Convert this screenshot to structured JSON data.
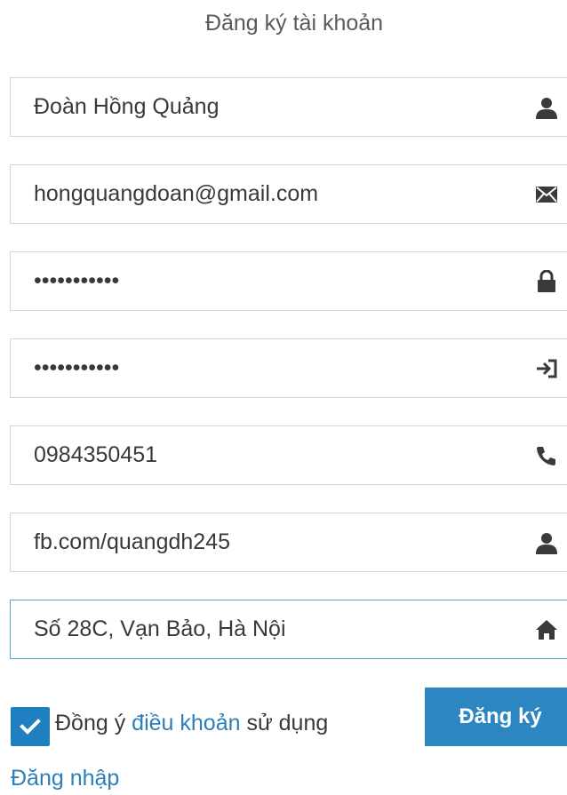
{
  "header": {
    "title": "Đăng ký tài khoản"
  },
  "form": {
    "fields": [
      {
        "value": "Đoàn Hồng Quảng",
        "icon": "user-icon"
      },
      {
        "value": "hongquangdoan@gmail.com",
        "icon": "envelope-icon"
      },
      {
        "value": "•••••••••••",
        "icon": "lock-icon"
      },
      {
        "value": "•••••••••••",
        "icon": "sign-in-icon"
      },
      {
        "value": "0984350451",
        "icon": "phone-icon"
      },
      {
        "value": "fb.com/quangdh245",
        "icon": "user-icon"
      },
      {
        "value": "Số 28C, Vạn Bảo, Hà Nội",
        "icon": "home-icon"
      }
    ],
    "agree": {
      "checked": true,
      "text_before": "Đồng ý",
      "link": "điều khoản",
      "text_after": "sử dụng"
    },
    "submit_label": "Đăng ký",
    "login_link": "Đăng nhập"
  },
  "colors": {
    "accent": "#2c86c2",
    "link": "#2d7fb8",
    "focus_border": "#5ba3d6",
    "border": "#d5d5d5"
  }
}
